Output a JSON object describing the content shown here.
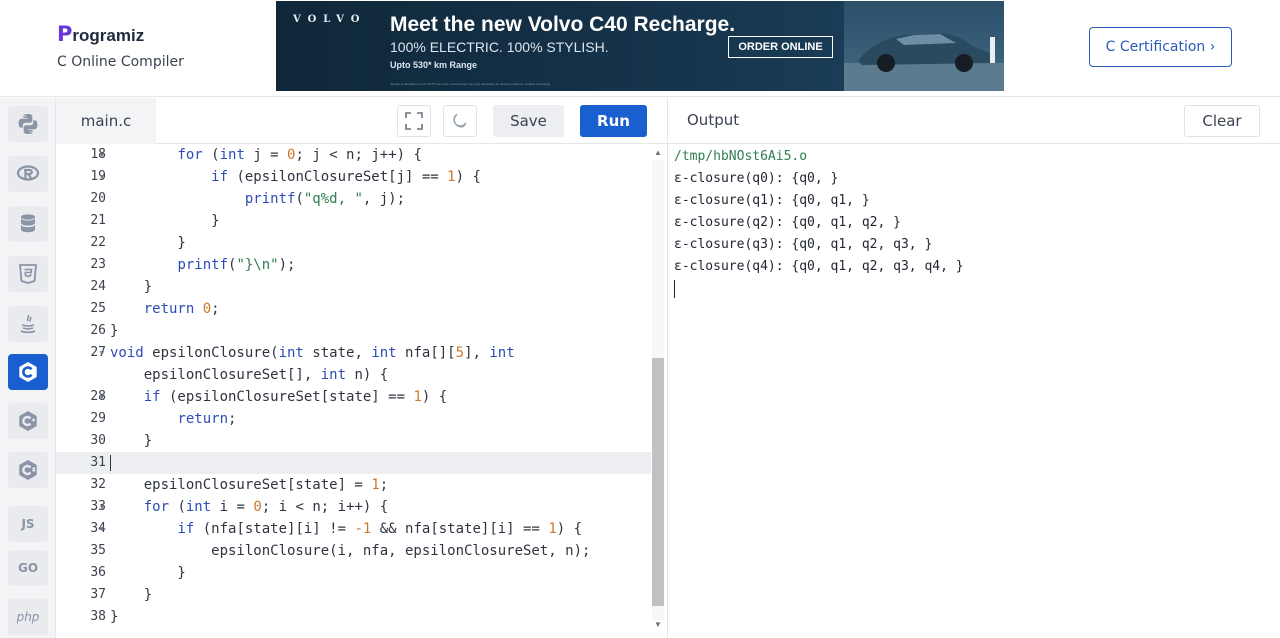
{
  "header": {
    "logo_mark": "P",
    "logo_text": "rogramiz",
    "subtitle": "C Online Compiler",
    "cert_button": "C Certification ›"
  },
  "ad": {
    "brand": "VOLVO",
    "headline": "Meet the new Volvo C40 Recharge.",
    "line2": "100% ELECTRIC. 100% STYLISH.",
    "line3": "Upto 530* km Range",
    "fine_print": "*Range is calculated as per WLTP test cycle. Actual range may vary depending on driving conditions, weather and usage.",
    "cta": "ORDER ONLINE"
  },
  "sidebar": {
    "items": [
      {
        "name": "python",
        "icon": "python-icon",
        "label": ""
      },
      {
        "name": "r",
        "icon": "r-icon",
        "label": ""
      },
      {
        "name": "sql",
        "icon": "database-icon",
        "label": ""
      },
      {
        "name": "html",
        "icon": "html5-icon",
        "label": "5"
      },
      {
        "name": "java",
        "icon": "java-icon",
        "label": ""
      },
      {
        "name": "c",
        "icon": "c-icon",
        "label": "C",
        "active": true
      },
      {
        "name": "cpp",
        "icon": "cpp-icon",
        "label": "C"
      },
      {
        "name": "csharp",
        "icon": "csharp-icon",
        "label": "C"
      },
      {
        "name": "js",
        "icon": "js-icon",
        "label": "JS"
      },
      {
        "name": "go",
        "icon": "go-icon",
        "label": "GO"
      },
      {
        "name": "php",
        "icon": "php-icon",
        "label": "php"
      }
    ]
  },
  "editor": {
    "file_tab": "main.c",
    "save_label": "Save",
    "run_label": "Run",
    "lines": [
      {
        "num": "18",
        "fold": true,
        "indent": 2
      },
      {
        "num": "19",
        "fold": true,
        "indent": 3
      },
      {
        "num": "20",
        "fold": false,
        "indent": 4
      },
      {
        "num": "21",
        "fold": false,
        "indent": 3
      },
      {
        "num": "22",
        "fold": false,
        "indent": 2
      },
      {
        "num": "23",
        "fold": false,
        "indent": 2
      },
      {
        "num": "24",
        "fold": false,
        "indent": 1
      },
      {
        "num": "25",
        "fold": false,
        "indent": 1
      },
      {
        "num": "26",
        "fold": false,
        "indent": 0
      },
      {
        "num": "27",
        "fold": true,
        "indent": 0
      },
      {
        "num": "",
        "fold": false,
        "indent": 0,
        "wrap": true
      },
      {
        "num": "28",
        "fold": true,
        "indent": 1
      },
      {
        "num": "29",
        "fold": false,
        "indent": 2
      },
      {
        "num": "30",
        "fold": false,
        "indent": 1
      },
      {
        "num": "31",
        "fold": false,
        "indent": 0,
        "highlight": true
      },
      {
        "num": "32",
        "fold": false,
        "indent": 1
      },
      {
        "num": "33",
        "fold": true,
        "indent": 1
      },
      {
        "num": "34",
        "fold": true,
        "indent": 2
      },
      {
        "num": "35",
        "fold": false,
        "indent": 3
      },
      {
        "num": "36",
        "fold": false,
        "indent": 2
      },
      {
        "num": "37",
        "fold": false,
        "indent": 1
      },
      {
        "num": "38",
        "fold": false,
        "indent": 0
      }
    ]
  },
  "output": {
    "title": "Output",
    "clear_label": "Clear",
    "lines": [
      "/tmp/hbNOst6Ai5.o",
      "ε-closure(q0): {q0, }",
      "ε-closure(q1): {q0, q1, }",
      "ε-closure(q2): {q0, q1, q2, }",
      "ε-closure(q3): {q0, q1, q2, q3, }",
      "ε-closure(q4): {q0, q1, q2, q3, q4, }"
    ]
  }
}
